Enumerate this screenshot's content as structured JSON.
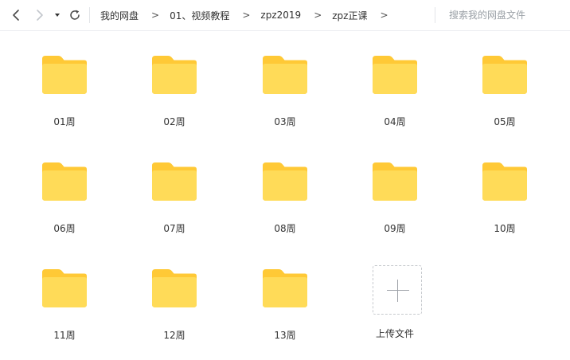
{
  "breadcrumb": [
    "我的网盘",
    "01、视频教程",
    "zpz2019",
    "zpz正课"
  ],
  "breadcrumb_separator": ">",
  "search": {
    "placeholder": "搜索我的网盘文件",
    "value": ""
  },
  "folders": [
    "01周",
    "02周",
    "03周",
    "04周",
    "05周",
    "06周",
    "07周",
    "08周",
    "09周",
    "10周",
    "11周",
    "12周",
    "13周"
  ],
  "upload": {
    "label": "上传文件"
  },
  "colors": {
    "folder_back": "#ffc936",
    "folder_front": "#ffdb58",
    "icon": "#4a4a4a",
    "icon_disabled": "#c2c6cc"
  },
  "icons": [
    "back-icon",
    "forward-icon",
    "dropdown-icon",
    "refresh-icon",
    "folder-icon",
    "plus-icon"
  ]
}
